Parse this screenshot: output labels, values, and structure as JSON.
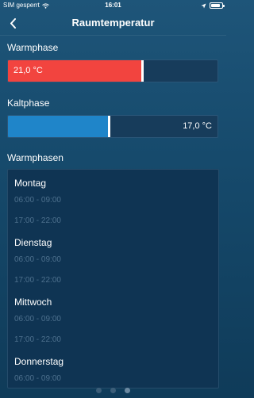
{
  "status": {
    "carrier": "SIM gesperrt",
    "time": "16:01",
    "battery_level": 0.85
  },
  "nav": {
    "title": "Raumtemperatur",
    "back_icon": "chevron-left-icon"
  },
  "warm": {
    "label": "Warmphase",
    "value": "21,0 °C",
    "fill_fraction": 0.64,
    "color": "#f2443f"
  },
  "cold": {
    "label": "Kaltphase",
    "value": "17,0 °C",
    "fill_fraction": 0.48,
    "color": "#1f85c9"
  },
  "schedule": {
    "title": "Warmphasen",
    "days": [
      {
        "name": "Montag",
        "slots": [
          "06:00 - 09:00",
          "17:00 - 22:00"
        ]
      },
      {
        "name": "Dienstag",
        "slots": [
          "06:00 - 09:00",
          "17:00 - 22:00"
        ]
      },
      {
        "name": "Mittwoch",
        "slots": [
          "06:00 - 09:00",
          "17:00 - 22:00"
        ]
      },
      {
        "name": "Donnerstag",
        "slots": [
          "06:00 - 09:00"
        ]
      }
    ]
  },
  "pagination": {
    "count": 3,
    "active": 2
  }
}
